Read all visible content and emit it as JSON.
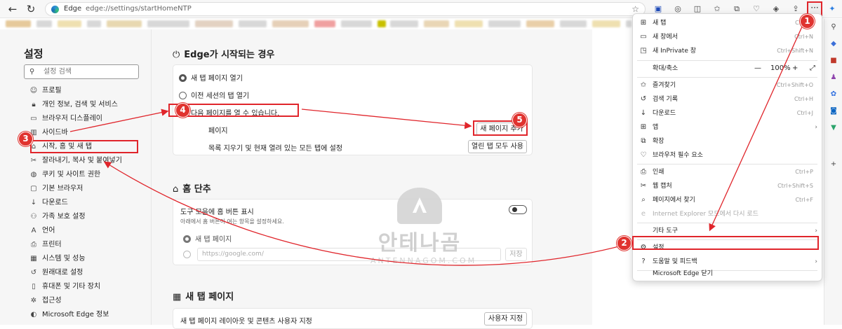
{
  "browser": {
    "tab_label": "Edge",
    "url": "edge://settings/startHomeNTP",
    "more_button": "···"
  },
  "sidebar": {
    "title": "설정",
    "search_placeholder": "설정 검색",
    "items": [
      {
        "label": "프로필",
        "icon": "profile-icon"
      },
      {
        "label": "개인 정보, 검색 및 서비스",
        "icon": "lock-icon"
      },
      {
        "label": "브라우저 디스플레이",
        "icon": "display-icon"
      },
      {
        "label": "사이드바",
        "icon": "sidebar-icon"
      },
      {
        "label": "시작, 홈 및 새 탭",
        "icon": "home-tab-icon"
      },
      {
        "label": "잘라내기, 복사 및 붙여넣기",
        "icon": "clipboard-icon"
      },
      {
        "label": "쿠키 및 사이트 권한",
        "icon": "cookie-icon"
      },
      {
        "label": "기본 브라우저",
        "icon": "browser-icon"
      },
      {
        "label": "다운로드",
        "icon": "download-icon"
      },
      {
        "label": "가족 보호 설정",
        "icon": "family-icon"
      },
      {
        "label": "언어",
        "icon": "language-icon"
      },
      {
        "label": "프린터",
        "icon": "printer-icon"
      },
      {
        "label": "시스템 및 성능",
        "icon": "system-icon"
      },
      {
        "label": "원래대로 설정",
        "icon": "reset-icon"
      },
      {
        "label": "휴대폰 및 기타 장치",
        "icon": "phone-icon"
      },
      {
        "label": "접근성",
        "icon": "accessibility-icon"
      },
      {
        "label": "Microsoft Edge 정보",
        "icon": "edge-icon"
      }
    ]
  },
  "startup": {
    "heading": "Edge가 시작되는 경우",
    "option_new_tab": "새 탭 페이지 열기",
    "option_prev_session": "이전 세션의 탭 열기",
    "option_open_pages": "다음 페이지를 열 수 있습니다.",
    "pages_label": "페이지",
    "add_page_button": "새 페이지 추가",
    "clear_label": "목록 지우기 및 현재 열려 있는 모든 탭에 설정",
    "use_open_tabs_button": "열린 탭 모두 사용"
  },
  "home": {
    "heading": "홈 단추",
    "toolbar_toggle_label": "도구 모음에 홈 버튼 표시",
    "subtitle": "아래에서 홈 버튼이 여는 항목을 설정하세요.",
    "option_new_tab": "새 탭 페이지",
    "url_placeholder": "https://google.com/",
    "save_button": "저장"
  },
  "newtab": {
    "heading": "새 탭 페이지",
    "customize_label": "새 탭 페이지 레이아웃 및 콘텐츠 사용자 지정",
    "customize_button": "사용자 지정"
  },
  "menu": {
    "items": [
      {
        "label": "새 탭",
        "shortcut": "Ctrl+T",
        "icon": "new-tab-icon"
      },
      {
        "label": "새 창에서",
        "shortcut": "Ctrl+N",
        "icon": "new-window-icon"
      },
      {
        "label": "새 InPrivate 창",
        "shortcut": "Ctrl+Shift+N",
        "icon": "inprivate-icon"
      },
      {
        "label": "확대/축소",
        "zoom": "100%",
        "minus": "—",
        "plus": "+",
        "icon": ""
      },
      {
        "label": "즐겨찾기",
        "shortcut": "Ctrl+Shift+O",
        "icon": "favorites-icon"
      },
      {
        "label": "검색 기록",
        "shortcut": "Ctrl+H",
        "icon": "history-icon"
      },
      {
        "label": "다운로드",
        "shortcut": "Ctrl+J",
        "icon": "download-icon"
      },
      {
        "label": "앱",
        "shortcut": "",
        "icon": "apps-icon"
      },
      {
        "label": "확장",
        "shortcut": "",
        "icon": "extensions-icon"
      },
      {
        "label": "브라우저 필수 요소",
        "shortcut": "",
        "icon": "essentials-icon"
      },
      {
        "label": "인쇄",
        "shortcut": "Ctrl+P",
        "icon": "print-icon"
      },
      {
        "label": "웹 캡처",
        "shortcut": "Ctrl+Shift+S",
        "icon": "capture-icon"
      },
      {
        "label": "페이지에서 찾기",
        "shortcut": "Ctrl+F",
        "icon": "find-icon"
      },
      {
        "label": "Internet Explorer 모드에서 다시 로드",
        "shortcut": "",
        "icon": "ie-icon"
      },
      {
        "label": "기타 도구",
        "shortcut": "",
        "icon": ""
      },
      {
        "label": "설정",
        "shortcut": "",
        "icon": "settings-icon"
      },
      {
        "label": "도움말 및 피드백",
        "shortcut": "",
        "icon": "help-icon"
      },
      {
        "label": "Microsoft Edge 닫기",
        "shortcut": "",
        "icon": ""
      }
    ]
  },
  "watermark": {
    "korean": "안테나곰",
    "english": "ANTENNAGOM.COM"
  },
  "badges": [
    "1",
    "2",
    "3",
    "4",
    "5"
  ],
  "colors": {
    "annotation_red": "#e0252b",
    "accent": "#0067c0"
  }
}
